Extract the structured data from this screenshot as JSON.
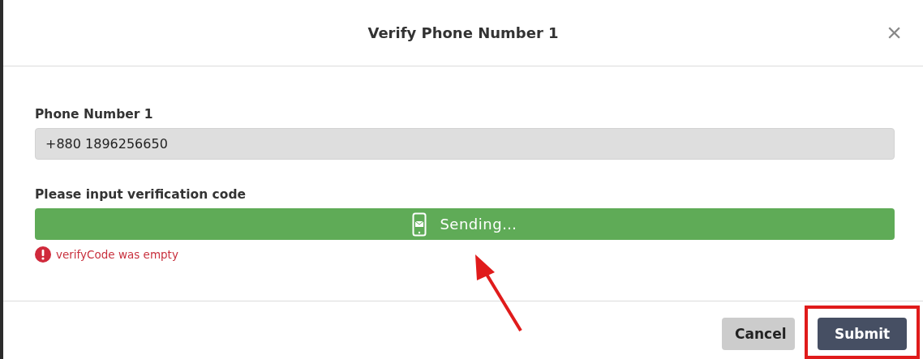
{
  "dialog": {
    "title": "Verify Phone Number 1",
    "close_icon": "×"
  },
  "phone_field": {
    "label": "Phone Number 1",
    "value": "+880 1896256650",
    "disabled": true
  },
  "verification": {
    "label": "Please input verification code",
    "send_button": {
      "label": "Sending…",
      "disabled": false
    },
    "error": "verifyCode was empty"
  },
  "buttons": [
    {
      "label": "Cancel",
      "kind": "secondary"
    },
    {
      "label": "Submit",
      "kind": "primary"
    }
  ]
}
